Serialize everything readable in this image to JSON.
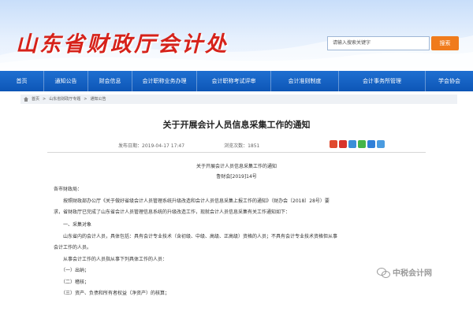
{
  "header": {
    "site_title": "山东省财政厅会计处",
    "search": {
      "placeholder": "请输入搜索关键字",
      "button_label": "搜索"
    }
  },
  "nav": {
    "items": [
      {
        "label": "首页"
      },
      {
        "label": "通知公告"
      },
      {
        "label": "财会信息"
      },
      {
        "label": "会计职称业务办理"
      },
      {
        "label": "会计职称考试评审"
      },
      {
        "label": "会计准则制度"
      },
      {
        "label": "会计事务所管理"
      },
      {
        "label": "学会协会"
      }
    ]
  },
  "breadcrumb": {
    "items": [
      "首页",
      "山东省财政厅专题",
      "通知公告"
    ]
  },
  "article": {
    "title": "关于开展会计人员信息采集工作的通知",
    "publish_time": "发布日期：2019-04-17 17:47",
    "views": "浏览次数：1851",
    "sub_title": "关于开展会计人员信息采集工作的通知",
    "doc_no": "鲁财会[2019]14号",
    "paragraphs": [
      "各市财政局：",
      "　　按照财政部办公厅《关于做好省级会计人员管理系统升级改造和会计人员信息采集上报工作的通知》（财办会〔2018〕28号）要",
      "求，省财政厅已完成了山东省会计人员管理信息系统的升级改造工作，现就会计人员信息采集有关工作通知如下：",
      "　　一、采集对象",
      "　　山东省内的会计人员，具体包括：具有会计专业技术（含初级、中级、高级、正高级）资格的人员；不具有会计专业技术资格但从事",
      "会计工作的人员。",
      "　　从事会计工作的人员指从事下列具体工作的人员：",
      "　　（一）出纳；",
      "　　（二）稽核；",
      "　　（三）资产、负债和所有者权益（净资产）的核算；"
    ]
  },
  "watermark": {
    "text": "中税会计网"
  },
  "colors": {
    "nav_bg": "#0d56b6",
    "title_red": "#d6221a",
    "search_btn": "#f07b1c"
  }
}
